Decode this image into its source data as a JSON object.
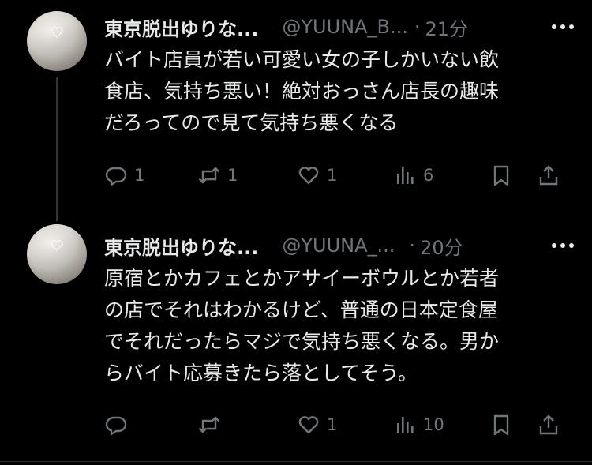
{
  "posts": [
    {
      "name": "東京脱出ゆりな...",
      "handle": "@YUUNA_B...",
      "separator": "·",
      "time": "21分",
      "text_lines": [
        "バイト店員が若い可愛い女の子しかいない飲",
        "食店、気持ち悪い！絶対おっさん店長の趣味",
        "だろってので見て気持ち悪くなる"
      ],
      "actions": {
        "reply_count": "1",
        "repost_count": "1",
        "like_count": "1",
        "view_count": "6"
      },
      "icons": [
        "avatar",
        "more-icon",
        "reply-icon",
        "repost-icon",
        "like-icon",
        "views-icon",
        "bookmark-icon",
        "share-icon"
      ]
    },
    {
      "name": "東京脱出ゆりな...",
      "handle": "@YUUNA_...",
      "separator": "·",
      "time": "20分",
      "text_lines": [
        "原宿とかカフェとかアサイーボウルとか若者",
        "の店でそれはわかるけど、普通の日本定食屋",
        "でそれだったらマジで気持ち悪くなる。男か",
        "らバイト応募きたら落としてそう。"
      ],
      "actions": {
        "reply_count": "",
        "repost_count": "",
        "like_count": "1",
        "view_count": "10"
      },
      "icons": [
        "avatar",
        "more-icon",
        "reply-icon",
        "repost-icon",
        "like-icon",
        "views-icon",
        "bookmark-icon",
        "share-icon"
      ]
    }
  ],
  "colors": {
    "background": "#000000",
    "primary_text": "#e7e9ea",
    "secondary_text": "#71767b",
    "thread_line": "#333639"
  }
}
